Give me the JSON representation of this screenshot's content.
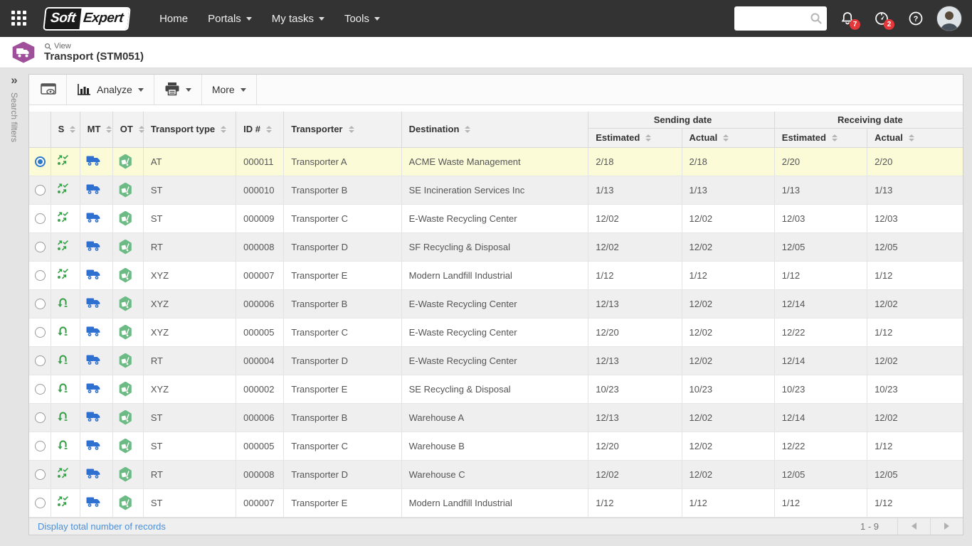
{
  "topbar": {
    "brand": {
      "part1": "Soft",
      "part2": "Expert"
    },
    "menu": [
      {
        "label": "Home"
      },
      {
        "label": "Portals"
      },
      {
        "label": "My tasks"
      },
      {
        "label": "Tools"
      }
    ],
    "badges": {
      "notifications": "7",
      "tasks": "2"
    }
  },
  "page_header": {
    "kicker": "View",
    "title": "Transport (STM051)"
  },
  "sidebar": {
    "label": "Search filters"
  },
  "toolbar": {
    "analyze_label": "Analyze",
    "more_label": "More"
  },
  "table": {
    "columns": [
      "S",
      "MT",
      "OT",
      "Transport type",
      "ID #",
      "Transporter",
      "Destination"
    ],
    "groups": [
      "Sending date",
      "Receiving date"
    ],
    "subcolumns": [
      "Estimated",
      "Actual",
      "Estimated",
      "Actual"
    ],
    "rows": [
      {
        "selected": true,
        "s": "transfer",
        "type": "AT",
        "id": "000011",
        "transporter": "Transporter A",
        "destination": "ACME Waste Management",
        "send_est": "2/18",
        "send_act": "2/18",
        "recv_est": "2/20",
        "recv_act": "2/20"
      },
      {
        "selected": false,
        "s": "transfer",
        "type": "ST",
        "id": "000010",
        "transporter": "Transporter B",
        "destination": "SE Incineration Services Inc",
        "send_est": "1/13",
        "send_act": "1/13",
        "recv_est": "1/13",
        "recv_act": "1/13"
      },
      {
        "selected": false,
        "s": "transfer",
        "type": "ST",
        "id": "000009",
        "transporter": "Transporter C",
        "destination": "E-Waste Recycling Center",
        "send_est": "12/02",
        "send_act": "12/02",
        "recv_est": "12/03",
        "recv_act": "12/03"
      },
      {
        "selected": false,
        "s": "transfer",
        "type": "RT",
        "id": "000008",
        "transporter": "Transporter D",
        "destination": "SF Recycling & Disposal",
        "send_est": "12/02",
        "send_act": "12/02",
        "recv_est": "12/05",
        "recv_act": "12/05"
      },
      {
        "selected": false,
        "s": "transfer",
        "type": "XYZ",
        "id": "000007",
        "transporter": "Transporter E",
        "destination": "Modern Landfill Industrial",
        "send_est": "1/12",
        "send_act": "1/12",
        "recv_est": "1/12",
        "recv_act": "1/12"
      },
      {
        "selected": false,
        "s": "return",
        "type": "XYZ",
        "id": "000006",
        "transporter": "Transporter B",
        "destination": "E-Waste Recycling Center",
        "send_est": "12/13",
        "send_act": "12/02",
        "recv_est": "12/14",
        "recv_act": "12/02"
      },
      {
        "selected": false,
        "s": "return",
        "type": "XYZ",
        "id": "000005",
        "transporter": "Transporter C",
        "destination": "E-Waste Recycling Center",
        "send_est": "12/20",
        "send_act": "12/02",
        "recv_est": "12/22",
        "recv_act": "1/12"
      },
      {
        "selected": false,
        "s": "return",
        "type": "RT",
        "id": "000004",
        "transporter": "Transporter D",
        "destination": "E-Waste Recycling Center",
        "send_est": "12/13",
        "send_act": "12/02",
        "recv_est": "12/14",
        "recv_act": "12/02"
      },
      {
        "selected": false,
        "s": "return",
        "type": "XYZ",
        "id": "000002",
        "transporter": "Transporter E",
        "destination": "SE Recycling & Disposal",
        "send_est": "10/23",
        "send_act": "10/23",
        "recv_est": "10/23",
        "recv_act": "10/23"
      },
      {
        "selected": false,
        "s": "return",
        "type": "ST",
        "id": "000006",
        "transporter": "Transporter B",
        "destination": "Warehouse A",
        "send_est": "12/13",
        "send_act": "12/02",
        "recv_est": "12/14",
        "recv_act": "12/02"
      },
      {
        "selected": false,
        "s": "return",
        "type": "ST",
        "id": "000005",
        "transporter": "Transporter C",
        "destination": "Warehouse B",
        "send_est": "12/20",
        "send_act": "12/02",
        "recv_est": "12/22",
        "recv_act": "1/12"
      },
      {
        "selected": false,
        "s": "transfer",
        "type": "RT",
        "id": "000008",
        "transporter": "Transporter D",
        "destination": "Warehouse C",
        "send_est": "12/02",
        "send_act": "12/02",
        "recv_est": "12/05",
        "recv_act": "12/05"
      },
      {
        "selected": false,
        "s": "transfer",
        "type": "ST",
        "id": "000007",
        "transporter": "Transporter E",
        "destination": "Modern Landfill Industrial",
        "send_est": "1/12",
        "send_act": "1/12",
        "recv_est": "1/12",
        "recv_act": "1/12"
      }
    ]
  },
  "footer": {
    "link": "Display total number of records",
    "range": "1 - 9"
  },
  "colors": {
    "topbar_bg": "#333333",
    "badge_red": "#e5383b",
    "link_blue": "#4a90d9",
    "selected_row": "#fbfbd8",
    "status_green": "#3aa04a",
    "truck_blue": "#2e6fd0",
    "object_hex_green": "#6cba84",
    "module_purple": "#a0509a"
  }
}
